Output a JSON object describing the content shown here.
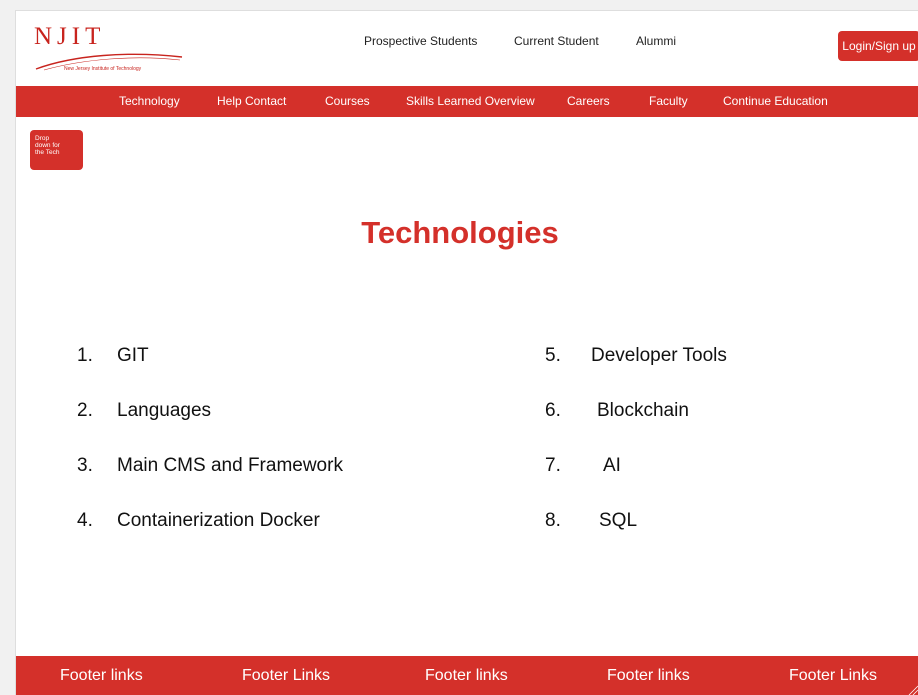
{
  "header": {
    "logo": {
      "letters": "NJIT",
      "tagline": "New Jersey Institute of Technology"
    },
    "top_links": [
      "Prospective Students",
      "Current Student",
      "Alummi"
    ],
    "login_label": "Login/Sign up"
  },
  "main_nav": [
    "Technology",
    "Help Contact",
    "Courses",
    "Skills Learned Overview",
    "Careers",
    "Faculty",
    "Continue Education"
  ],
  "dropdown_button": {
    "lines": [
      "Drop",
      "down for",
      "the Tech"
    ]
  },
  "page_title": "Technologies",
  "technologies_left": [
    {
      "num": "1.",
      "label": "GIT"
    },
    {
      "num": "2.",
      "label": "Languages"
    },
    {
      "num": "3.",
      "label": "Main CMS and Framework"
    },
    {
      "num": "4.",
      "label": "Containerization Docker"
    }
  ],
  "technologies_right": [
    {
      "num": "5.",
      "label": "Developer Tools"
    },
    {
      "num": "6.",
      "label": "Blockchain"
    },
    {
      "num": "7.",
      "label": "AI"
    },
    {
      "num": "8.",
      "label": "SQL"
    }
  ],
  "footer_links": [
    "Footer links",
    "Footer Links",
    "Footer links",
    "Footer links",
    "Footer Links"
  ],
  "colors": {
    "brand_red": "#d4302a",
    "text": "#111111",
    "background": "#ffffff"
  }
}
